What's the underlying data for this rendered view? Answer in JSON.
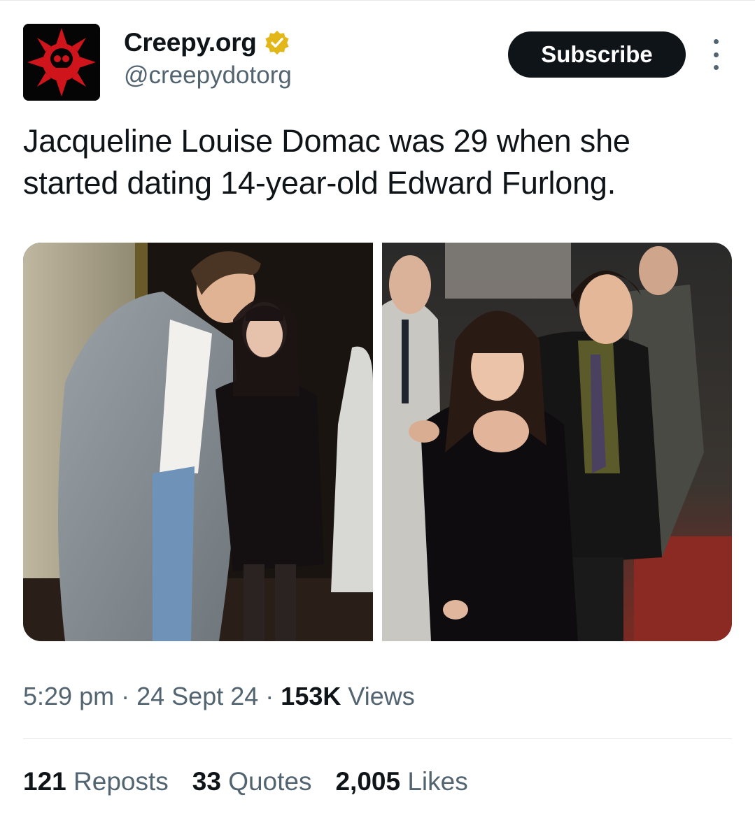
{
  "account": {
    "display_name": "Creepy.org",
    "handle": "@creepydotorg",
    "verified_icon": "verified-badge-gold",
    "avatar_icon": "red-skull-emblem"
  },
  "header": {
    "subscribe_label": "Subscribe",
    "more_icon": "vertical-ellipsis"
  },
  "tweet": {
    "text": "Jacqueline Louise Domac was 29 when she started dating 14-year-old Edward Furlong."
  },
  "media": {
    "count": 2
  },
  "meta": {
    "time": "5:29 pm",
    "separator": "·",
    "date": "24 Sept 24",
    "views_count": "153K",
    "views_label": "Views"
  },
  "stats": {
    "reposts_count": "121",
    "reposts_label": "Reposts",
    "quotes_count": "33",
    "quotes_label": "Quotes",
    "likes_count": "2,005",
    "likes_label": "Likes"
  },
  "colors": {
    "text_primary": "#0f1419",
    "text_secondary": "#536471",
    "subscribe_bg": "#0f1419",
    "verified_gold": "#e2b719",
    "avatar_red": "#d0141c"
  }
}
